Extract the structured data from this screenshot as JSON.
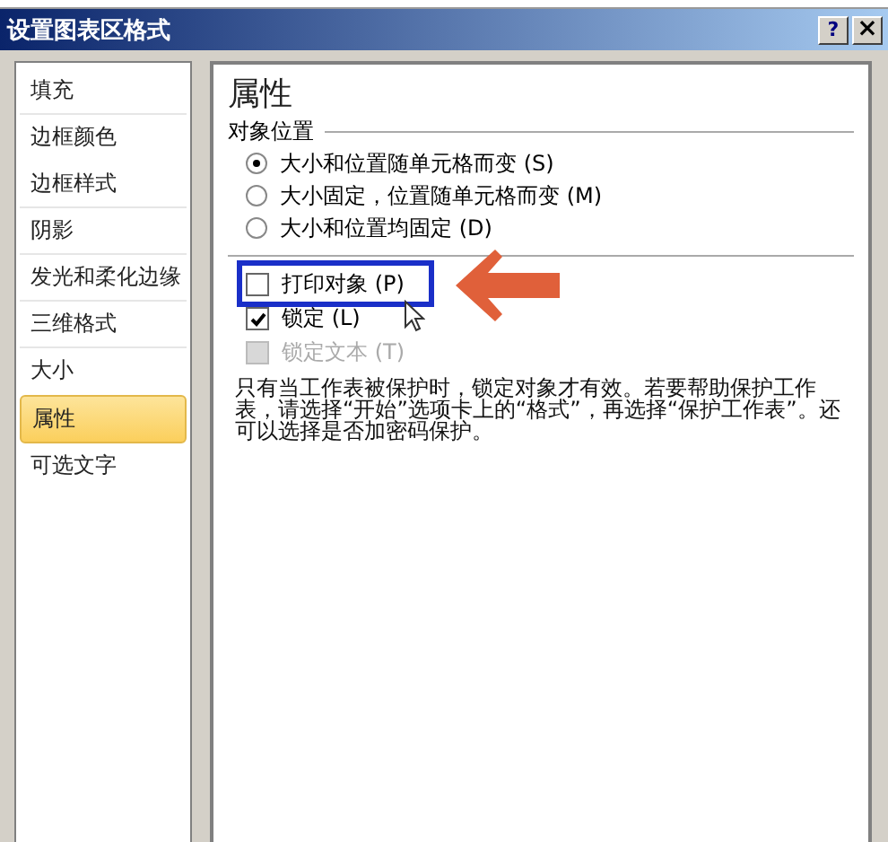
{
  "window": {
    "title": "设置图表区格式",
    "buttons": [
      {
        "kind": "help",
        "label": "?"
      },
      {
        "kind": "close",
        "label": "×"
      }
    ]
  },
  "sidebar": {
    "items": [
      {
        "label": "填充",
        "selected": false,
        "separator": true
      },
      {
        "label": "边框颜色",
        "selected": false,
        "separator": false
      },
      {
        "label": "边框样式",
        "selected": false,
        "separator": true
      },
      {
        "label": "阴影",
        "selected": false,
        "separator": true
      },
      {
        "label": "发光和柔化边缘",
        "selected": false,
        "separator": true
      },
      {
        "label": "三维格式",
        "selected": false,
        "separator": true
      },
      {
        "label": "大小",
        "selected": false,
        "separator": false
      },
      {
        "label": "属性",
        "selected": true,
        "separator": false
      },
      {
        "label": "可选文字",
        "selected": false,
        "separator": false
      }
    ]
  },
  "panel": {
    "heading": "属性",
    "group": "对象位置",
    "radios": [
      {
        "label": "大小和位置随单元格而变 (S)",
        "selected": true
      },
      {
        "label": "大小固定，位置随单元格而变 (M)",
        "selected": false
      },
      {
        "label": "大小和位置均固定 (D)",
        "selected": false
      }
    ],
    "checkboxes": [
      {
        "label": "打印对象 (P)",
        "checked": false,
        "disabled": false,
        "highlighted": true
      },
      {
        "label": "锁定 (L)",
        "checked": true,
        "disabled": false,
        "highlighted": false
      },
      {
        "label": "锁定文本 (T)",
        "checked": false,
        "disabled": true,
        "highlighted": false
      }
    ],
    "note": "只有当工作表被保护时，锁定对象才有效。若要帮助保护工作表，请选择“开始”选项卡上的“格式”，再选择“保护工作表”。还可以选择是否加密码保护。"
  }
}
